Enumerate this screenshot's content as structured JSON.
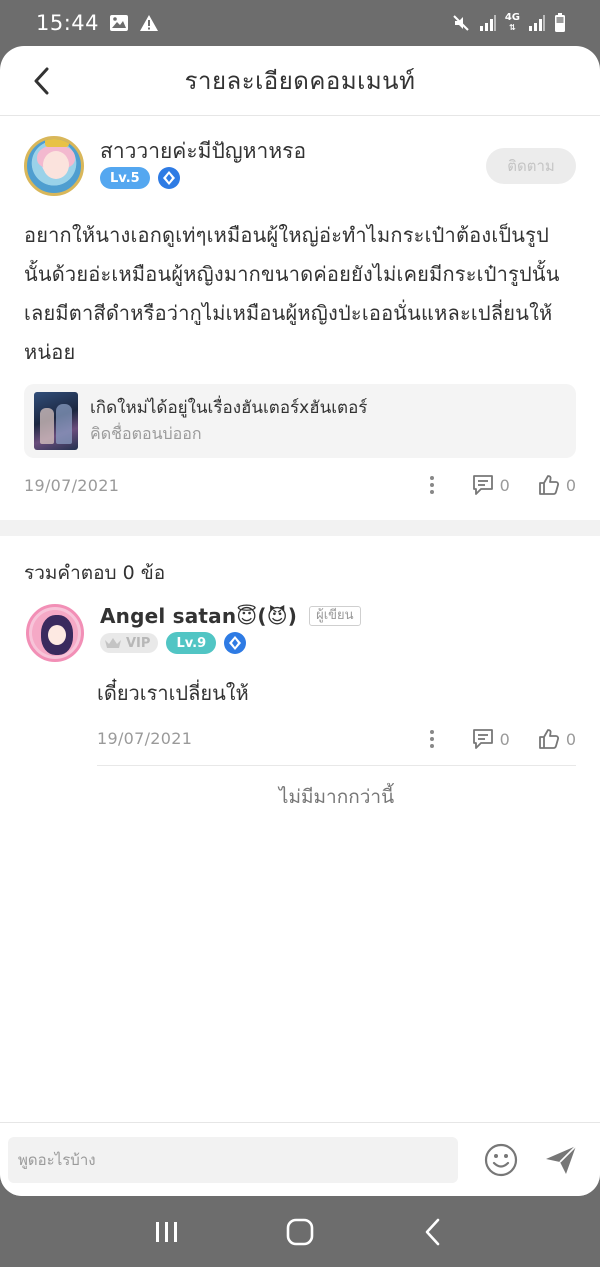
{
  "status_bar": {
    "time": "15:44",
    "network": "4G"
  },
  "header": {
    "title": "รายละเอียดคอมเมนท์"
  },
  "post": {
    "user_name": "สาววายค่ะมีปัญหาหรอ",
    "level": "Lv.5",
    "follow_label": "ติดตาม",
    "text": "อยากให้นางเอกดูเท่ๆเหมือนผู้ใหญ่อ่ะทำไมกระเป๋าต้องเป็นรูปนั้นด้วยอ่ะเหมือนผู้หญิงมากขนาดค่อยยังไม่เคยมีกระเป๋ารูปนั้นเลยมีตาสีดำหรือว่ากูไม่เหมือนผู้หญิงป่ะเออนั่นแหละเปลี่ยนให้หน่อย",
    "book": {
      "title": "เกิดใหม่ได้อยู่ในเรื่องฮันเตอร์xฮันเตอร์",
      "subtitle": "คิดชื่อตอนบ่ออก"
    },
    "date": "19/07/2021",
    "comments_count": "0",
    "likes_count": "0"
  },
  "replies_title": "รวมคำตอบ 0 ข้อ",
  "reply": {
    "user_name": "Angel satan😇(😈)",
    "author_tag": "ผู้เขียน",
    "vip": "VIP",
    "level": "Lv.9",
    "text": "เดี๋ยวเราเปลี่ยนให้",
    "date": "19/07/2021",
    "comments_count": "0",
    "likes_count": "0"
  },
  "no_more": "ไม่มีมากกว่านี้",
  "input": {
    "placeholder": "พูดอะไรบ้าง"
  },
  "colors": {
    "level_blue": "#54a7f0",
    "level_teal": "#51c5c4",
    "diamond": "#2e7be4"
  }
}
